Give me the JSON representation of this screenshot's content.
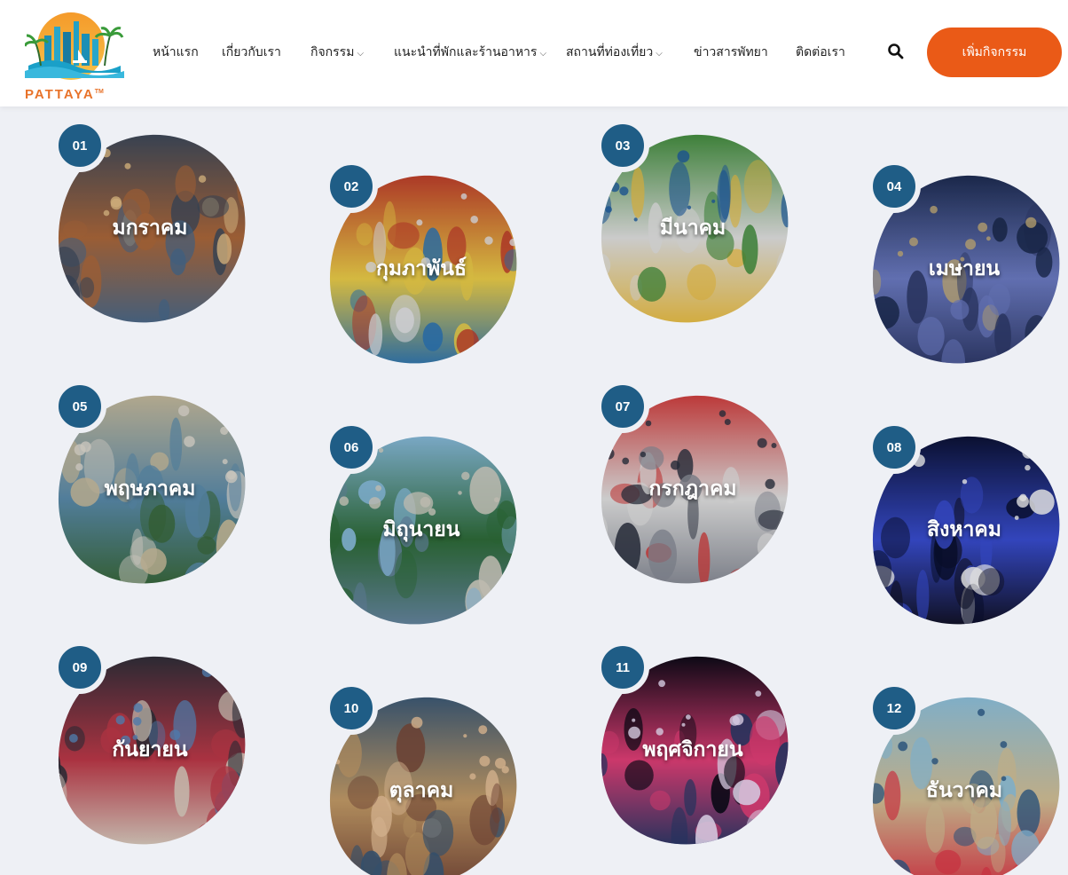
{
  "header": {
    "logo_text": "PATTAYA",
    "logo_mark": "TM",
    "nav": [
      {
        "label": "หน้าแรก",
        "dropdown": false
      },
      {
        "label": "เกี่ยวกับเรา",
        "dropdown": false
      },
      {
        "label": "กิจกรรม",
        "dropdown": true
      },
      {
        "label": "แนะนำที่พักและร้านอาหาร",
        "dropdown": true
      },
      {
        "label": "สถานที่ท่องเที่ยว",
        "dropdown": true
      },
      {
        "label": "ข่าวสารพัทยา",
        "dropdown": false
      },
      {
        "label": "ติดต่อเรา",
        "dropdown": false
      }
    ],
    "search_icon": "search-icon",
    "cta_label": "เพิ่มกิจกรรม",
    "accent": "#ea5a17",
    "badge_color": "#1f5d86"
  },
  "months": [
    {
      "num": "01",
      "label": "มกราคม",
      "photo": "night-market"
    },
    {
      "num": "02",
      "label": "กุมภาพันธ์",
      "photo": "pattaya-cup-press"
    },
    {
      "num": "03",
      "label": "มีนาคม",
      "photo": "st-patricks-parade"
    },
    {
      "num": "04",
      "label": "เมษายน",
      "photo": "stage-offerings"
    },
    {
      "num": "05",
      "label": "พฤษภาคม",
      "photo": "beach-surfball"
    },
    {
      "num": "06",
      "label": "มิถุนายน",
      "photo": "palm-runners"
    },
    {
      "num": "07",
      "label": "กรกฎาคม",
      "photo": "red-carpet-walk"
    },
    {
      "num": "08",
      "label": "สิงหาคม",
      "photo": "concert-crowd"
    },
    {
      "num": "09",
      "label": "กันยายน",
      "photo": "marathon-start"
    },
    {
      "num": "10",
      "label": "ตุลาคม",
      "photo": "beach-run-evening"
    },
    {
      "num": "11",
      "label": "พฤศจิกายน",
      "photo": "fireworks"
    },
    {
      "num": "12",
      "label": "ธันวาคม",
      "photo": "kite-festival"
    }
  ]
}
